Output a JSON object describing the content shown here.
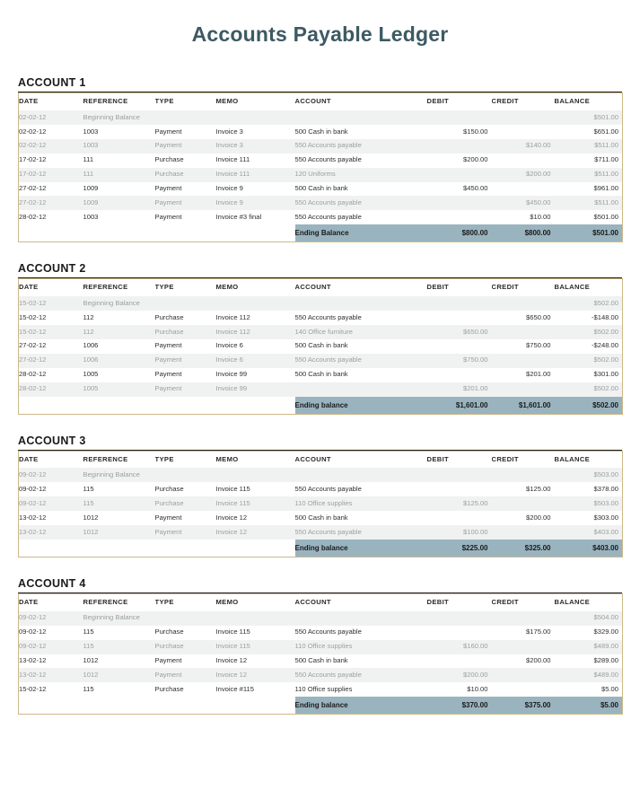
{
  "document": {
    "title": "Accounts Payable Ledger"
  },
  "columns": {
    "date": "DATE",
    "reference": "REFERENCE",
    "type": "TYPE",
    "memo": "MEMO",
    "account": "ACCOUNT",
    "debit": "DEBIT",
    "credit": "CREDIT",
    "balance": "BALANCE"
  },
  "colors": {
    "title": "#3d5a63",
    "table_border": "#cdb98a",
    "ending_band": "#9ab4bf",
    "row_alt": "#f0f2f1",
    "heading_rule": "#1a1a1a"
  },
  "accounts": [
    {
      "heading": "ACCOUNT 1",
      "rows": [
        {
          "date": "02-02-12",
          "reference": "Beginning Balance",
          "type": "",
          "memo": "",
          "account": "",
          "debit": "",
          "credit": "",
          "balance": "$501.00",
          "style": "begin"
        },
        {
          "date": "02-02-12",
          "reference": "1003",
          "type": "Payment",
          "memo": "Invoice 3",
          "account": "500 Cash in bank",
          "debit": "$150.00",
          "credit": "",
          "balance": "$651.00",
          "style": "dark"
        },
        {
          "date": "02-02-12",
          "reference": "1003",
          "type": "Payment",
          "memo": "Invoice 3",
          "account": "550 Accounts payable",
          "debit": "",
          "credit": "$140.00",
          "balance": "$511.00",
          "style": "light"
        },
        {
          "date": "17-02-12",
          "reference": "111",
          "type": "Purchase",
          "memo": "Invoice 111",
          "account": "550 Accounts payable",
          "debit": "$200.00",
          "credit": "",
          "balance": "$711.00",
          "style": "dark"
        },
        {
          "date": "17-02-12",
          "reference": "111",
          "type": "Purchase",
          "memo": "Invoice 111",
          "account": "120 Uniforms",
          "debit": "",
          "credit": "$200.00",
          "balance": "$511.00",
          "style": "light"
        },
        {
          "date": "27-02-12",
          "reference": "1009",
          "type": "Payment",
          "memo": "Invoice 9",
          "account": "500 Cash in bank",
          "debit": "$450.00",
          "credit": "",
          "balance": "$961.00",
          "style": "dark"
        },
        {
          "date": "27-02-12",
          "reference": "1009",
          "type": "Payment",
          "memo": "Invoice 9",
          "account": "550 Accounts payable",
          "debit": "",
          "credit": "$450.00",
          "balance": "$511.00",
          "style": "light"
        },
        {
          "date": "28-02-12",
          "reference": "1003",
          "type": "Payment",
          "memo": "Invoice #3 final",
          "account": "550 Accounts payable",
          "debit": "",
          "credit": "$10.00",
          "balance": "$501.00",
          "style": "dark"
        }
      ],
      "ending": {
        "label": "Ending Balance",
        "debit": "$800.00",
        "credit": "$800.00",
        "balance": "$501.00"
      }
    },
    {
      "heading": "ACCOUNT 2",
      "rows": [
        {
          "date": "15-02-12",
          "reference": "Beginning Balance",
          "type": "",
          "memo": "",
          "account": "",
          "debit": "",
          "credit": "",
          "balance": "$502.00",
          "style": "begin"
        },
        {
          "date": "15-02-12",
          "reference": "112",
          "type": "Purchase",
          "memo": "Invoice 112",
          "account": "550 Accounts payable",
          "debit": "",
          "credit": "$650.00",
          "balance": "-$148.00",
          "style": "dark"
        },
        {
          "date": "15-02-12",
          "reference": "112",
          "type": "Purchase",
          "memo": "Invoice 112",
          "account": "140 Office furniture",
          "debit": "$650.00",
          "credit": "",
          "balance": "$502.00",
          "style": "light"
        },
        {
          "date": "27-02-12",
          "reference": "1006",
          "type": "Payment",
          "memo": "Invoice 6",
          "account": "500 Cash in bank",
          "debit": "",
          "credit": "$750.00",
          "balance": "-$248.00",
          "style": "dark"
        },
        {
          "date": "27-02-12",
          "reference": "1006",
          "type": "Payment",
          "memo": "Invoice 6",
          "account": "550 Accounts payable",
          "debit": "$750.00",
          "credit": "",
          "balance": "$502.00",
          "style": "light"
        },
        {
          "date": "28-02-12",
          "reference": "1005",
          "type": "Payment",
          "memo": "Invoice 99",
          "account": "500 Cash in bank",
          "debit": "",
          "credit": "$201.00",
          "balance": "$301.00",
          "style": "dark"
        },
        {
          "date": "28-02-12",
          "reference": "1005",
          "type": "Payment",
          "memo": "Invoice 99",
          "account": "",
          "debit": "$201.00",
          "credit": "",
          "balance": "$502.00",
          "style": "light"
        }
      ],
      "ending": {
        "label": "Ending balance",
        "debit": "$1,601.00",
        "credit": "$1,601.00",
        "balance": "$502.00"
      }
    },
    {
      "heading": "ACCOUNT 3",
      "rows": [
        {
          "date": "09-02-12",
          "reference": "Beginning Balance",
          "type": "",
          "memo": "",
          "account": "",
          "debit": "",
          "credit": "",
          "balance": "$503.00",
          "style": "begin"
        },
        {
          "date": "09-02-12",
          "reference": "115",
          "type": "Purchase",
          "memo": "Invoice 115",
          "account": "550 Accounts payable",
          "debit": "",
          "credit": "$125.00",
          "balance": "$378.00",
          "style": "dark"
        },
        {
          "date": "09-02-12",
          "reference": "115",
          "type": "Purchase",
          "memo": "Invoice 115",
          "account": "110 Office supplies",
          "debit": "$125.00",
          "credit": "",
          "balance": "$503.00",
          "style": "light"
        },
        {
          "date": "13-02-12",
          "reference": "1012",
          "type": "Payment",
          "memo": "Invoice 12",
          "account": "500 Cash in bank",
          "debit": "",
          "credit": "$200.00",
          "balance": "$303.00",
          "style": "dark"
        },
        {
          "date": "13-02-12",
          "reference": "1012",
          "type": "Payment",
          "memo": "Invoice 12",
          "account": "550 Accounts payable",
          "debit": "$100.00",
          "credit": "",
          "balance": "$403.00",
          "style": "light"
        }
      ],
      "ending": {
        "label": "Ending balance",
        "debit": "$225.00",
        "credit": "$325.00",
        "balance": "$403.00"
      }
    },
    {
      "heading": "ACCOUNT 4",
      "rows": [
        {
          "date": "09-02-12",
          "reference": "Beginning Balance",
          "type": "",
          "memo": "",
          "account": "",
          "debit": "",
          "credit": "",
          "balance": "$504.00",
          "style": "begin"
        },
        {
          "date": "09-02-12",
          "reference": "115",
          "type": "Purchase",
          "memo": "Invoice 115",
          "account": "550 Accounts payable",
          "debit": "",
          "credit": "$175.00",
          "balance": "$329.00",
          "style": "dark"
        },
        {
          "date": "09-02-12",
          "reference": "115",
          "type": "Purchase",
          "memo": "Invoice 115",
          "account": "110 Office supplies",
          "debit": "$160.00",
          "credit": "",
          "balance": "$489.00",
          "style": "light"
        },
        {
          "date": "13-02-12",
          "reference": "1012",
          "type": "Payment",
          "memo": "Invoice 12",
          "account": "500 Cash in bank",
          "debit": "",
          "credit": "$200.00",
          "balance": "$289.00",
          "style": "dark"
        },
        {
          "date": "13-02-12",
          "reference": "1012",
          "type": "Payment",
          "memo": "Invoice 12",
          "account": "550 Accounts payable",
          "debit": "$200.00",
          "credit": "",
          "balance": "$489.00",
          "style": "light"
        },
        {
          "date": "15-02-12",
          "reference": "115",
          "type": "Purchase",
          "memo": "Invoice #115",
          "account": "110 Office supplies",
          "debit": "$10.00",
          "credit": "",
          "balance": "$5.00",
          "style": "dark"
        }
      ],
      "ending": {
        "label": "Ending balance",
        "debit": "$370.00",
        "credit": "$375.00",
        "balance": "$5.00"
      }
    }
  ]
}
